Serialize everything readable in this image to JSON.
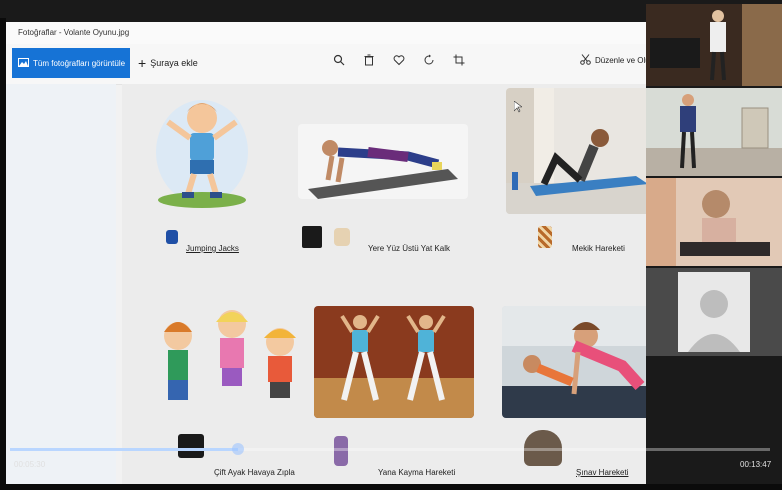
{
  "window": {
    "title": "Fotoğraflar - Volante Oyunu.jpg"
  },
  "toolbar": {
    "all_photos_label": "Tüm fotoğrafları görüntüle",
    "add_label": "Şuraya ekle",
    "edit_label": "Düzenle ve Olu"
  },
  "slide": {
    "exercises": [
      {
        "label": "Jumping Jacks"
      },
      {
        "label": "Yere Yüz Üstü Yat Kalk"
      },
      {
        "label": "Mekik Hareketi"
      },
      {
        "label": "Çift Ayak Havaya Zıpla"
      },
      {
        "label": "Yana Kayma Hareketi"
      },
      {
        "label": "Şınav Hareketi"
      }
    ]
  },
  "video": {
    "time_elapsed": "00:05:30",
    "time_total": "00:13:47",
    "progress_fraction": 0.3
  },
  "colors": {
    "accent": "#1673d6"
  }
}
